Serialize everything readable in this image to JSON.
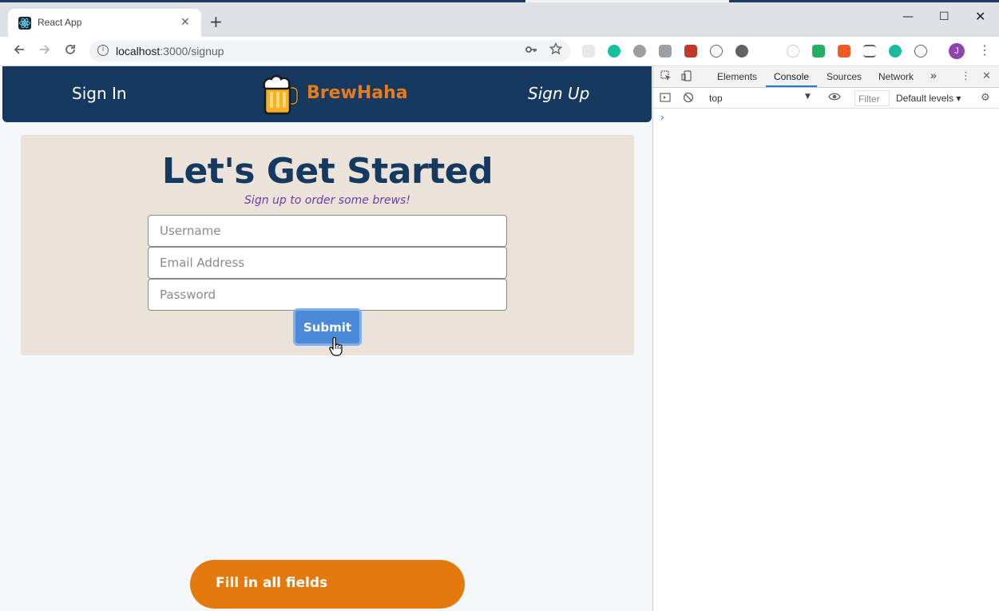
{
  "browser": {
    "tab_title": "React App",
    "tab_close": "✕",
    "new_tab": "+",
    "url_host": "localhost",
    "url_path": ":3000/signup",
    "window_min": "—",
    "window_max": "☐",
    "window_close": "✕",
    "profile_initial": "J",
    "icons": [
      "back-arrow-icon",
      "forward-arrow-icon",
      "reload-icon",
      "info-icon",
      "key-icon",
      "star-icon",
      "kebab-menu-icon"
    ]
  },
  "app": {
    "nav": {
      "sign_in": "Sign In",
      "brand": "BrewHaha",
      "sign_up": "Sign Up"
    },
    "signup": {
      "title": "Let's Get Started",
      "subtitle": "Sign up to order some brews!",
      "username_placeholder": "Username",
      "email_placeholder": "Email Address",
      "password_placeholder": "Password",
      "submit_label": "Submit"
    },
    "toast": {
      "message": "Fill in all fields"
    },
    "colors": {
      "nav_bg": "#163a5f",
      "brand": "#e57b1a",
      "card_bg": "#ebe2da",
      "heading": "#163a5f",
      "subtitle": "#6b3fa0",
      "submit_bg": "#4a8ad8",
      "toast_bg": "#e47a0d"
    }
  },
  "devtools": {
    "tabs": [
      "Elements",
      "Console",
      "Sources",
      "Network"
    ],
    "active_tab": "Console",
    "more_tabs": "»",
    "context": "top",
    "filter_placeholder": "Filter",
    "levels": "Default levels ▾",
    "prompt": "›"
  }
}
